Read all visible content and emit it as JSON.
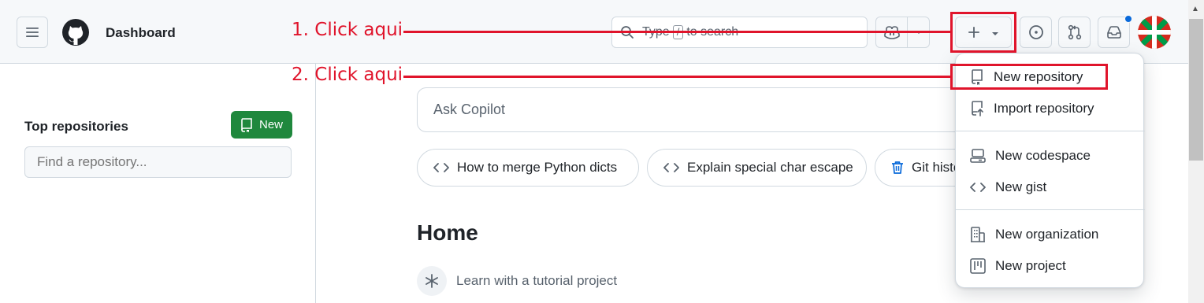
{
  "header": {
    "title": "Dashboard",
    "search": {
      "before": "Type",
      "key": "/",
      "after": "to search"
    }
  },
  "sidebar": {
    "heading": "Top repositories",
    "new_button": "New",
    "find_placeholder": "Find a repository..."
  },
  "main": {
    "ask_placeholder": "Ask Copilot",
    "chips": [
      "How to merge Python dicts",
      "Explain special char escape",
      "Git history"
    ],
    "home_title": "Home",
    "tutorial_link": "Learn with a tutorial project"
  },
  "create_menu": {
    "items": [
      "New repository",
      "Import repository",
      "New codespace",
      "New gist",
      "New organization",
      "New project"
    ]
  },
  "annotations": {
    "step1": "1. Click aqui",
    "step2": "2. Click aqui"
  },
  "colors": {
    "annotation": "#e0142b",
    "primary_button": "#1f883d",
    "notification_dot": "#0969da"
  }
}
